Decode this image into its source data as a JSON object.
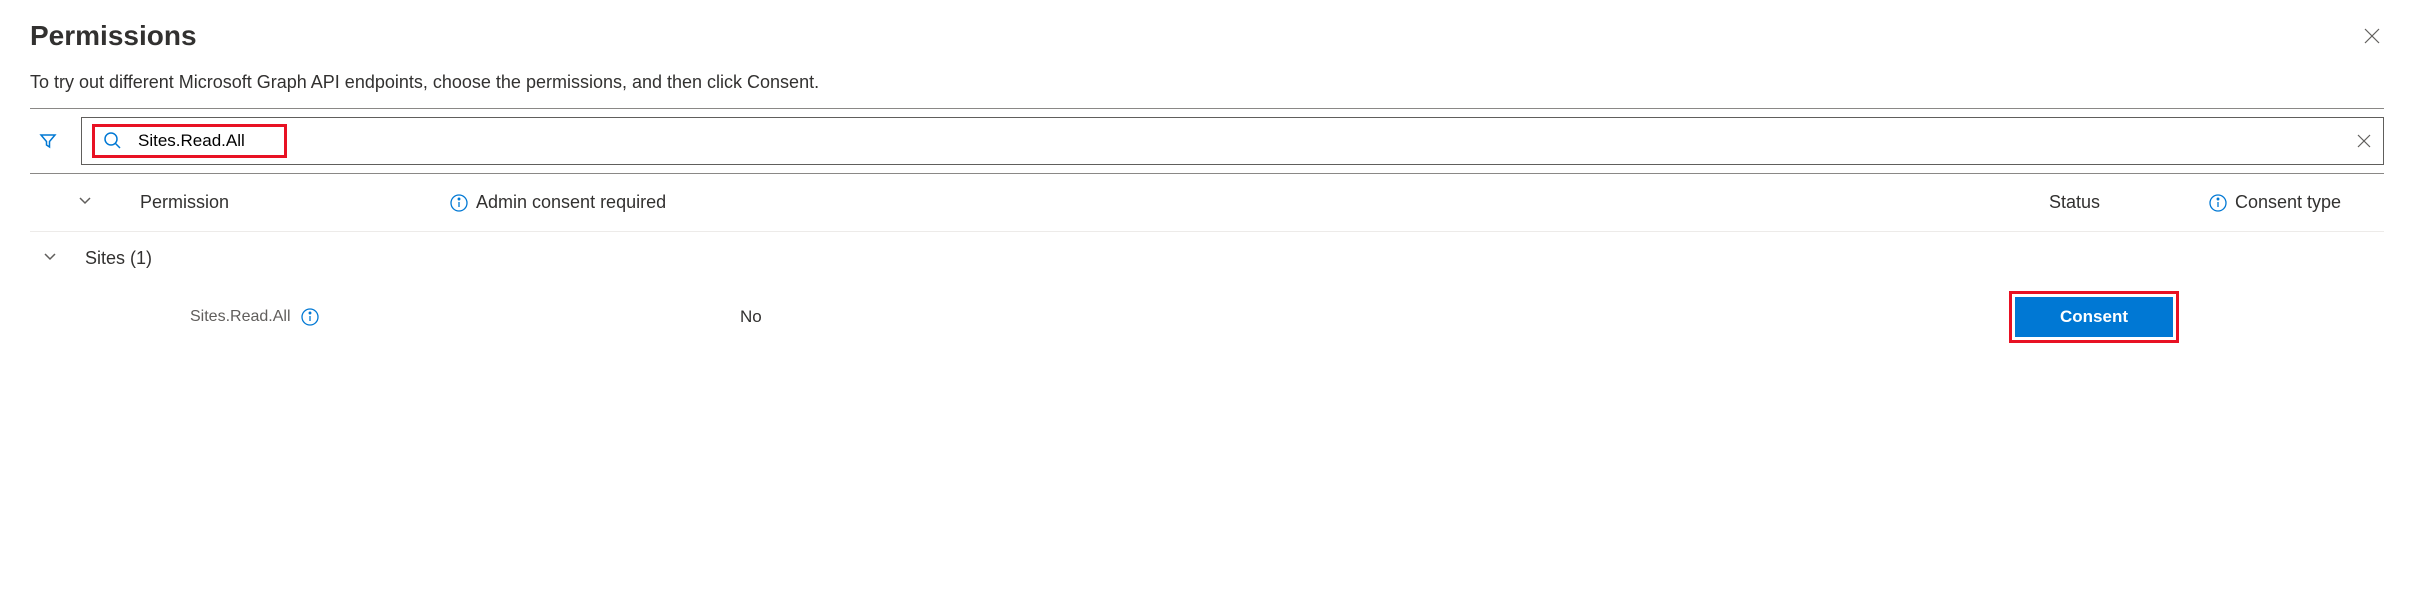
{
  "header": {
    "title": "Permissions",
    "subtitle": "To try out different Microsoft Graph API endpoints, choose the permissions, and then click Consent."
  },
  "search": {
    "value": "Sites.Read.All"
  },
  "columns": {
    "permission": "Permission",
    "admin_consent": "Admin consent required",
    "status": "Status",
    "consent_type": "Consent type"
  },
  "group": {
    "name": "Sites (1)"
  },
  "row": {
    "permission_name": "Sites.Read.All",
    "admin_required": "No",
    "consent_button": "Consent"
  }
}
